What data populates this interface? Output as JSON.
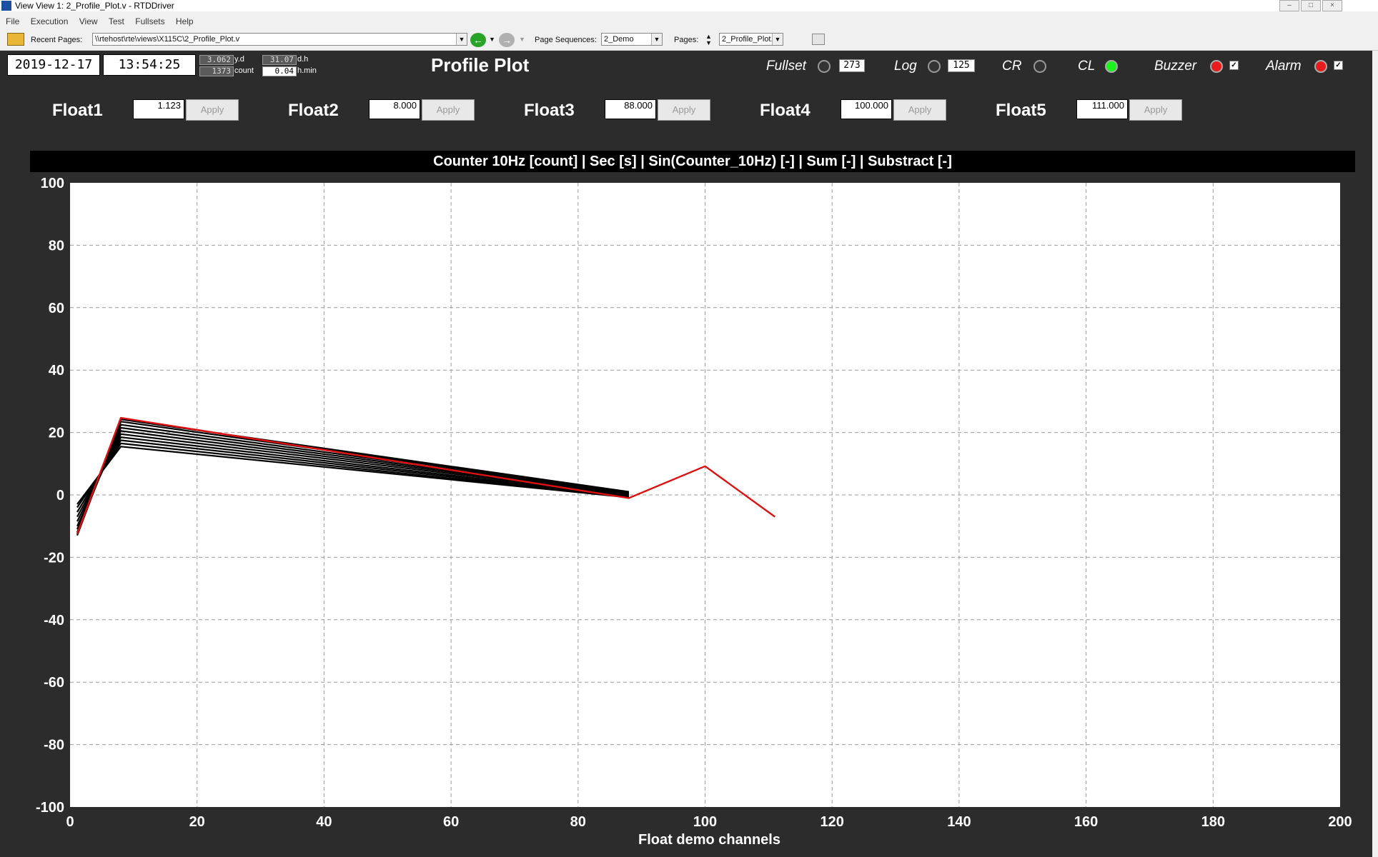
{
  "window": {
    "title": "View View 1: 2_Profile_Plot.v - RTDDriver"
  },
  "menu": [
    "File",
    "Execution",
    "View",
    "Test",
    "Fullsets",
    "Help"
  ],
  "toolbar": {
    "recent_pages_label": "Recent Pages:",
    "recent_pages_value": "\\\\rtehost\\rte\\views\\X115C\\2_Profile_Plot.v",
    "page_sequences_label": "Page Sequences:",
    "page_sequences_value": "2_Demo",
    "pages_label": "Pages:",
    "pages_value": "2_Profile_Plot.v"
  },
  "status": {
    "date": "2019-12-17",
    "time": "13:54:25",
    "yd_value": "3.062",
    "yd_unit": "y.d",
    "count_value": "1373",
    "count_unit": "count",
    "dh_value": "31.07",
    "dh_unit": "d.h",
    "hmin_value": "0.04",
    "hmin_unit": "h.min"
  },
  "page_title": "Profile Plot",
  "indicators": {
    "fullset_label": "Fullset",
    "fullset_value": "273",
    "log_label": "Log",
    "log_value": "125",
    "cr_label": "CR",
    "cl_label": "CL",
    "buzzer_label": "Buzzer",
    "alarm_label": "Alarm",
    "check_mark": "✓",
    "colors": {
      "led_green": "#1ef21e",
      "led_red": "#e81c1c",
      "led_off": "#333333"
    }
  },
  "floats": [
    {
      "label": "Float1",
      "value": "1.123",
      "apply": "Apply"
    },
    {
      "label": "Float2",
      "value": "8.000",
      "apply": "Apply"
    },
    {
      "label": "Float3",
      "value": "88.000",
      "apply": "Apply"
    },
    {
      "label": "Float4",
      "value": "100.000",
      "apply": "Apply"
    },
    {
      "label": "Float5",
      "value": "111.000",
      "apply": "Apply"
    }
  ],
  "chart_data": {
    "type": "line",
    "title": "Counter 10Hz [count] | Sec [s] | Sin(Counter_10Hz) [-] | Sum [-] | Substract [-]",
    "xlabel": "Float demo channels",
    "ylabel": "",
    "xlim": [
      0,
      200
    ],
    "ylim": [
      -100,
      100
    ],
    "xticks": [
      0,
      20,
      40,
      60,
      80,
      100,
      120,
      140,
      160,
      180,
      200
    ],
    "yticks": [
      100,
      80,
      60,
      40,
      20,
      0,
      -20,
      -40,
      -60,
      -80,
      -100
    ],
    "grid": true,
    "colors": {
      "current": "#dd1111",
      "history": "#000000"
    },
    "history_series": [
      {
        "x": [
          1.123,
          8,
          88
        ],
        "y": [
          -3,
          15.5,
          -0.8
        ]
      },
      {
        "x": [
          1.123,
          8,
          88
        ],
        "y": [
          -4,
          16.5,
          -0.7
        ]
      },
      {
        "x": [
          1.123,
          8,
          88
        ],
        "y": [
          -5.5,
          17.5,
          -0.5
        ]
      },
      {
        "x": [
          1.123,
          8,
          88
        ],
        "y": [
          -7,
          18.5,
          -0.3
        ]
      },
      {
        "x": [
          1.123,
          8,
          88
        ],
        "y": [
          -8.5,
          19.5,
          0
        ]
      },
      {
        "x": [
          1.123,
          8,
          88
        ],
        "y": [
          -10,
          20.5,
          0.2
        ]
      },
      {
        "x": [
          1.123,
          8,
          88
        ],
        "y": [
          -11,
          21.5,
          0.4
        ]
      },
      {
        "x": [
          1.123,
          8,
          88
        ],
        "y": [
          -12,
          22.5,
          0.6
        ]
      },
      {
        "x": [
          1.123,
          8,
          88
        ],
        "y": [
          -12.5,
          23.5,
          0.8
        ]
      },
      {
        "x": [
          1.123,
          8,
          88
        ],
        "y": [
          -13,
          24.2,
          1.0
        ]
      }
    ],
    "current_series": {
      "x": [
        1.123,
        8,
        88,
        100,
        111
      ],
      "y": [
        -12.5,
        24.7,
        -1.0,
        9.2,
        -7.0
      ]
    }
  }
}
